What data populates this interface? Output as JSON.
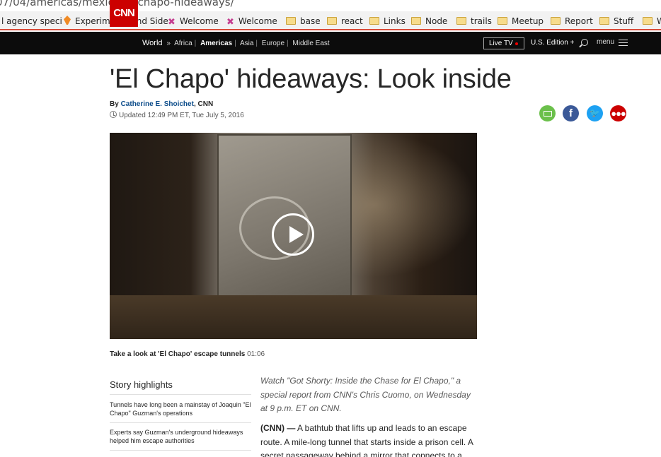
{
  "browser": {
    "url": "07/04/americas/mexico-el-chapo-hideaways/",
    "bookmarks": [
      {
        "label": "l agency speci",
        "icon": "none"
      },
      {
        "label": "Experiments and Side",
        "icon": "orange-diamond-icon"
      },
      {
        "label": "Welcome",
        "icon": "pinwheel-icon"
      },
      {
        "label": "Welcome",
        "icon": "pinwheel-icon"
      },
      {
        "label": "base",
        "icon": "folder-icon"
      },
      {
        "label": "react",
        "icon": "folder-icon"
      },
      {
        "label": "Links",
        "icon": "folder-icon"
      },
      {
        "label": "Node",
        "icon": "folder-icon"
      },
      {
        "label": "trails",
        "icon": "folder-icon"
      },
      {
        "label": "Meetup",
        "icon": "folder-icon"
      },
      {
        "label": "Report",
        "icon": "folder-icon"
      },
      {
        "label": "Stuff",
        "icon": "folder-icon"
      },
      {
        "label": "W",
        "icon": "folder-icon"
      }
    ]
  },
  "header": {
    "logo": "CNN",
    "nav": {
      "section": "World",
      "arrow": "»",
      "items": [
        "Africa",
        "Americas",
        "Asia",
        "Europe",
        "Middle East"
      ],
      "active": "Americas"
    },
    "live_tv": "Live TV",
    "edition": "U.S. Edition +",
    "menu": "menu"
  },
  "article": {
    "title": "'El Chapo' hideaways: Look inside",
    "by": "By",
    "author": "Catherine E. Shoichet",
    "source": ", CNN",
    "updated": "Updated 12:49 PM ET, Tue July 5, 2016",
    "video_caption": "Take a look at 'El Chapo' escape tunnels",
    "video_duration": "01:06",
    "highlights_title": "Story highlights",
    "highlights": [
      "Tunnels have long been a mainstay of Joaquin \"El Chapo\" Guzman's operations",
      "Experts say Guzman's underground hideaways helped him escape authorities"
    ],
    "intro_italic": "Watch \"Got Shorty: Inside the Chase for El Chapo,\" a special report from CNN's Chris Cuomo, on Wednesday at 9 p.m. ET on CNN.",
    "dateline": "(CNN) —",
    "paragraph": "A bathtub that lifts up and leads to an escape route. A mile-long tunnel that starts inside a prison cell. A secret passageway behind a mirror that connects to a"
  },
  "colors": {
    "cnn_red": "#cc0000",
    "nav_bg": "#0c0c0c",
    "author_link": "#0c4c8a",
    "email_green": "#6bc04b",
    "facebook_blue": "#3b5998",
    "twitter_blue": "#1da1f2"
  }
}
